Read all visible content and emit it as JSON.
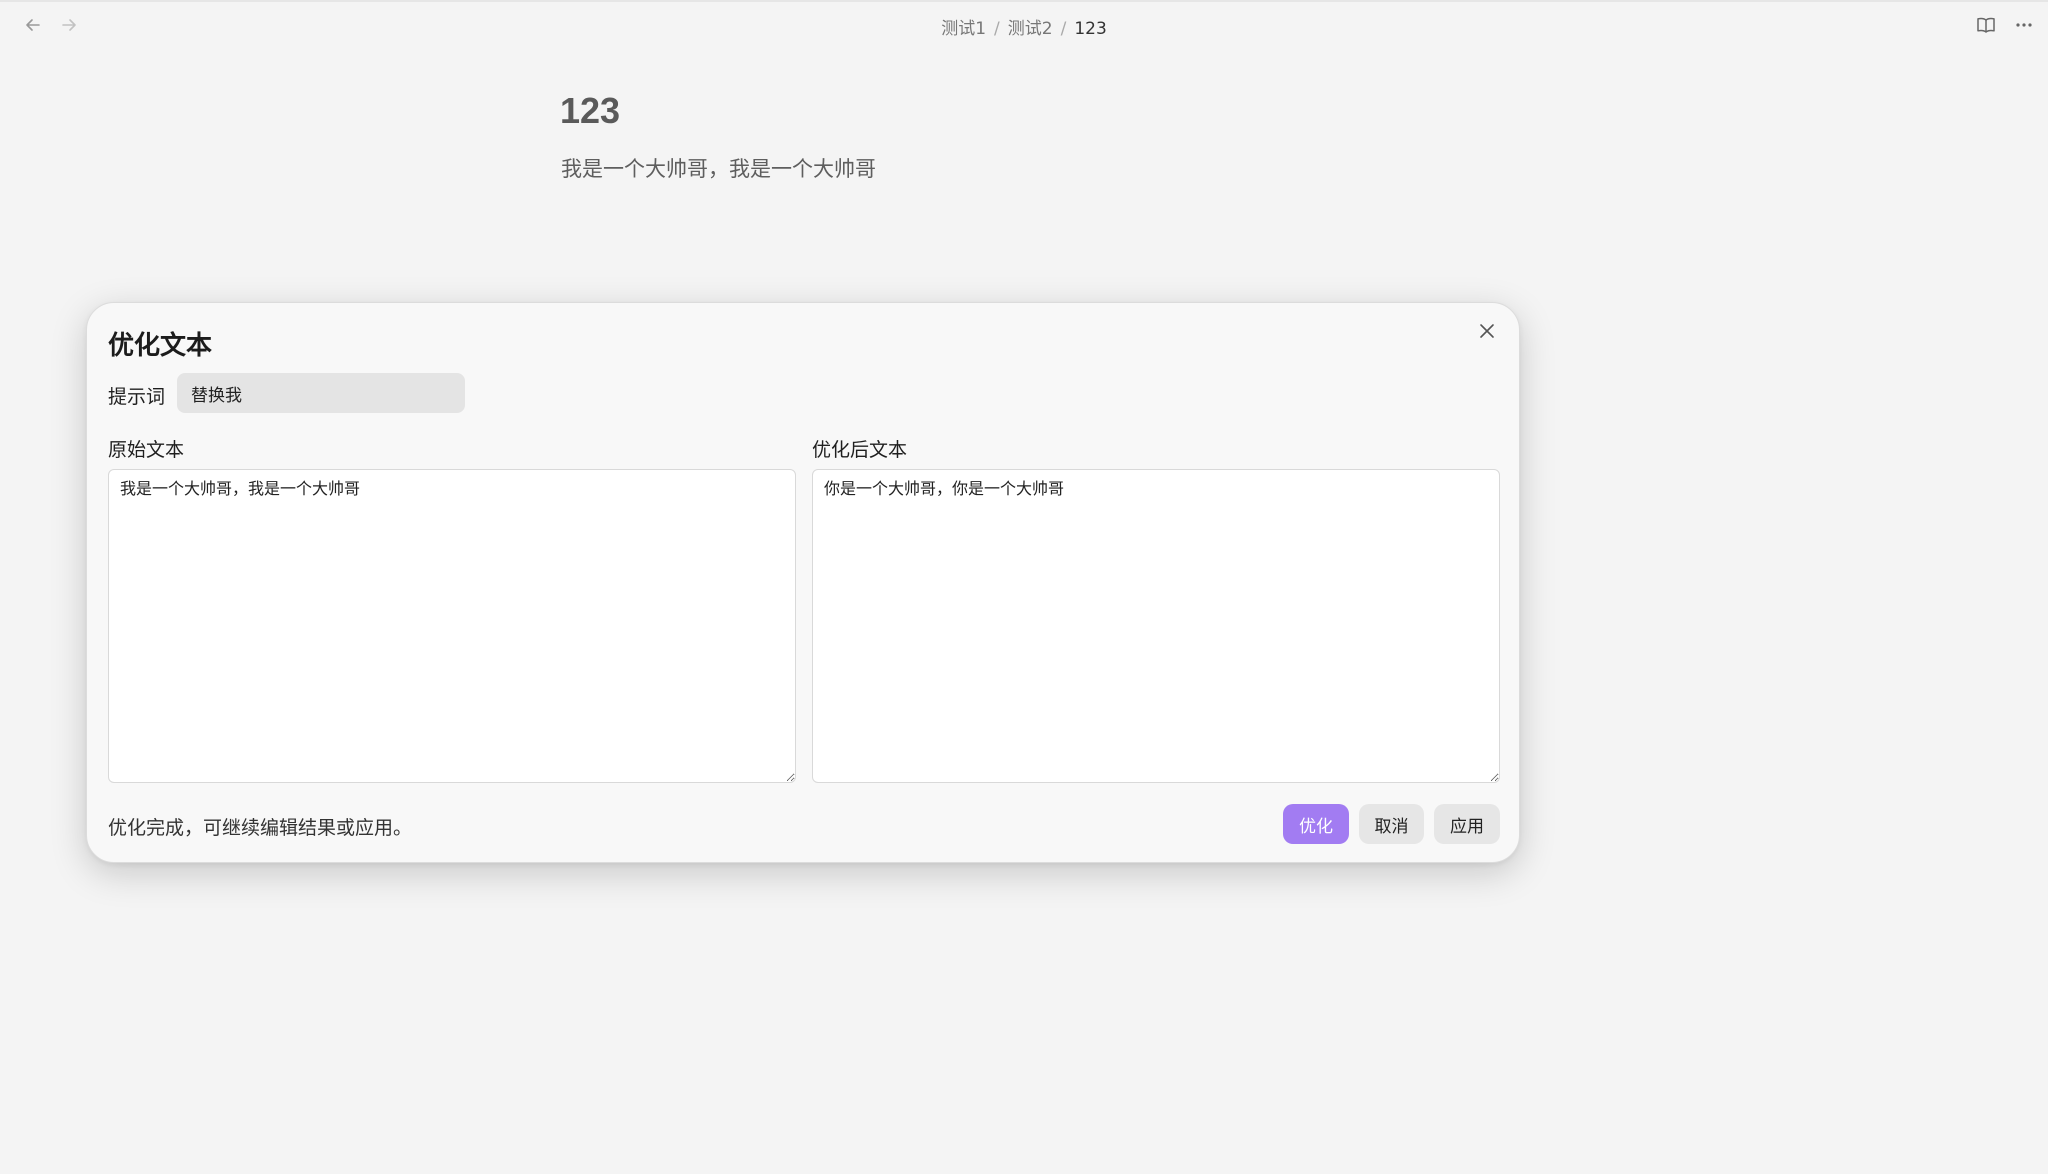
{
  "topbar": {
    "breadcrumb": [
      "测试1",
      "测试2",
      "123"
    ],
    "separator": "/"
  },
  "document": {
    "title": "123",
    "body": "我是一个大帅哥，我是一个大帅哥"
  },
  "dialog": {
    "title": "优化文本",
    "prompt_label": "提示词",
    "prompt_value": "替换我",
    "original_label": "原始文本",
    "original_text": "我是一个大帅哥，我是一个大帅哥",
    "optimized_label": "优化后文本",
    "optimized_text": "你是一个大帅哥，你是一个大帅哥",
    "status": "优化完成，可继续编辑结果或应用。",
    "buttons": {
      "optimize": "优化",
      "cancel": "取消",
      "apply": "应用"
    }
  },
  "colors": {
    "accent": "#a27cf2",
    "background": "#f4f4f4"
  },
  "icons": [
    "back-arrow-icon",
    "forward-arrow-icon",
    "book-icon",
    "more-icon",
    "close-icon"
  ]
}
